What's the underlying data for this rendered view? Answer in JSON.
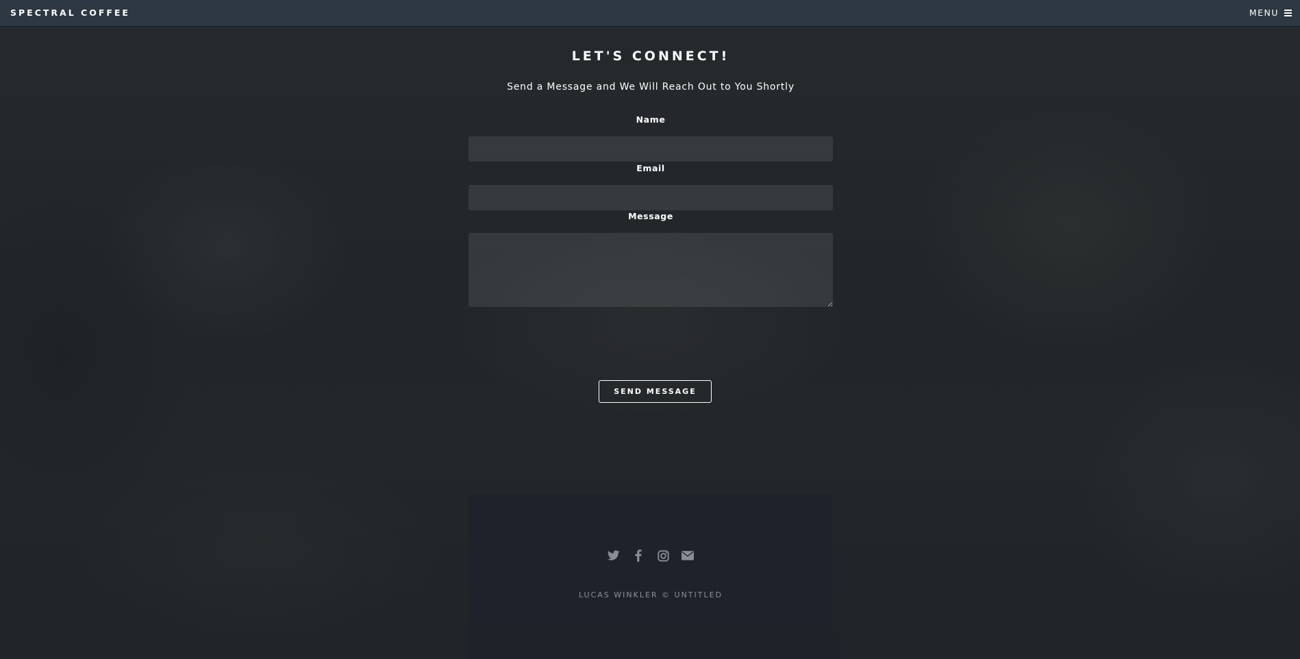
{
  "header": {
    "brand": "SPECTRAL COFFEE",
    "menu_label": "MENU",
    "menu_icon": "hamburger-icon"
  },
  "contact": {
    "title": "LET'S CONNECT!",
    "subtitle": "Send a Message and We Will Reach Out to You Shortly",
    "fields": {
      "name": {
        "label": "Name",
        "value": "",
        "placeholder": ""
      },
      "email": {
        "label": "Email",
        "value": "",
        "placeholder": ""
      },
      "message": {
        "label": "Message",
        "value": "",
        "placeholder": ""
      }
    },
    "submit_label": "SEND MESSAGE"
  },
  "footer": {
    "social_icons": [
      "twitter-icon",
      "facebook-icon",
      "instagram-icon",
      "envelope-icon"
    ],
    "copyright": "LUCAS WINKLER © UNTITLED"
  },
  "colors": {
    "header_bg": "#2e3842",
    "footer_text": "#8d9198",
    "icon": "#8a8e94"
  }
}
